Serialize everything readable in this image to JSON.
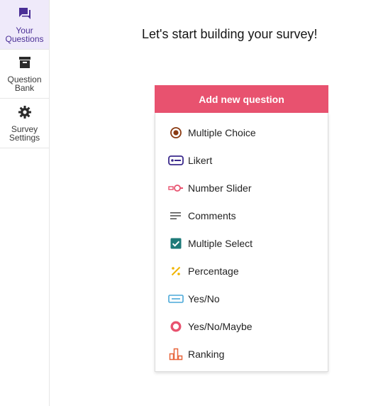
{
  "sidebar": {
    "items": [
      {
        "label": "Your Questions",
        "icon": "chat-bubbles-icon",
        "active": true
      },
      {
        "label": "Question Bank",
        "icon": "archive-box-icon",
        "active": false
      },
      {
        "label": "Survey Settings",
        "icon": "gear-icon",
        "active": false
      }
    ]
  },
  "main": {
    "heading": "Let's start building your survey!",
    "add_button_label": "Add new question",
    "question_types": [
      {
        "label": "Multiple Choice",
        "icon": "radio-button-icon",
        "color": "#8a3a12"
      },
      {
        "label": "Likert",
        "icon": "likert-scale-icon",
        "color": "#3b2a8c"
      },
      {
        "label": "Number Slider",
        "icon": "slider-icon",
        "color": "#e8526f"
      },
      {
        "label": "Comments",
        "icon": "text-lines-icon",
        "color": "#555555"
      },
      {
        "label": "Multiple Select",
        "icon": "checkbox-icon",
        "color": "#1e7a78"
      },
      {
        "label": "Percentage",
        "icon": "percent-icon",
        "color": "#f0b400"
      },
      {
        "label": "Yes/No",
        "icon": "toggle-box-icon",
        "color": "#4aa8d8"
      },
      {
        "label": "Yes/No/Maybe",
        "icon": "ring-icon",
        "color": "#e8526f"
      },
      {
        "label": "Ranking",
        "icon": "bar-ranking-icon",
        "color": "#e8663c"
      }
    ]
  },
  "colors": {
    "accent": "#e8526f",
    "sidebar_active_bg": "#efeafa",
    "sidebar_active_icon": "#4a2f96"
  }
}
